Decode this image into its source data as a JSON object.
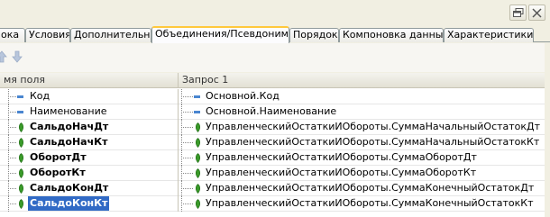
{
  "tabs": [
    {
      "label": "ока",
      "active": false
    },
    {
      "label": "Условия",
      "active": false
    },
    {
      "label": "Дополнительно",
      "active": false
    },
    {
      "label": "Объединения/Псевдонимы",
      "active": true
    },
    {
      "label": "Порядок",
      "active": false
    },
    {
      "label": "Компоновка данных",
      "active": false
    },
    {
      "label": "Характеристики",
      "active": false
    }
  ],
  "grid": {
    "col1_header": "мя поля",
    "col2_header": "Запрос 1",
    "rows": [
      {
        "name": "Код",
        "value": "Основной.Код",
        "bold": false,
        "icon": "field-icon"
      },
      {
        "name": "Наименование",
        "value": "Основной.Наименование",
        "bold": false,
        "icon": "field-icon"
      },
      {
        "name": "СальдоНачДт",
        "value": "УправленческийОстаткиИОбороты.СуммаНачальныйОстатокДт",
        "bold": true,
        "icon": "resource-icon"
      },
      {
        "name": "СальдоНачКт",
        "value": "УправленческийОстаткиИОбороты.СуммаНачальныйОстатокКт",
        "bold": true,
        "icon": "resource-icon"
      },
      {
        "name": "ОборотДт",
        "value": "УправленческийОстаткиИОбороты.СуммаОборотДт",
        "bold": true,
        "icon": "resource-icon"
      },
      {
        "name": "ОборотКт",
        "value": "УправленческийОстаткиИОбороты.СуммаОборотКт",
        "bold": true,
        "icon": "resource-icon"
      },
      {
        "name": "СальдоКонДт",
        "value": "УправленческийОстаткиИОбороты.СуммаКонечныйОстатокДт",
        "bold": true,
        "icon": "resource-icon"
      },
      {
        "name": "СальдоКонКт",
        "value": "УправленческийОстаткиИОбороты.СуммаКонечныйОстатокКт",
        "bold": true,
        "icon": "resource-icon",
        "selected": true
      }
    ]
  },
  "colors": {
    "accent_tab": "#ffc83c",
    "selection": "#316ac5",
    "field_icon": "#4a86d0",
    "resource_icon": "#3a9a2a"
  }
}
